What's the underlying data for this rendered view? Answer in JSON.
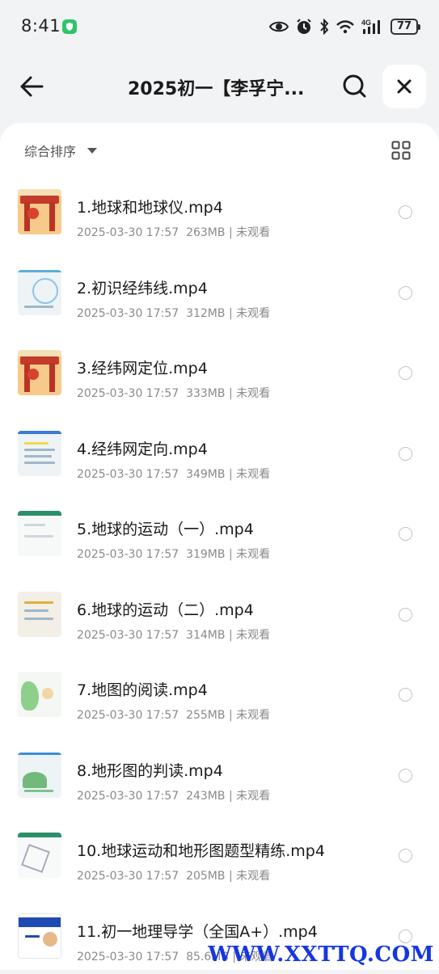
{
  "status_bar": {
    "time": "8:41",
    "network_label": "4G",
    "battery": "77",
    "icons": [
      "shield-icon",
      "eye-icon",
      "alarm-icon",
      "bluetooth-icon",
      "wifi-icon",
      "signal-icon",
      "battery-icon"
    ]
  },
  "header": {
    "title": "2025初一【李孚宁...",
    "icons": [
      "back-arrow-icon",
      "search-icon",
      "close-icon"
    ]
  },
  "toolbar": {
    "sort_label": "综合排序",
    "icons": [
      "caret-down-icon",
      "grid-view-icon"
    ]
  },
  "files": [
    {
      "name": "1.地球和地球仪.mp4",
      "date": "2025-03-30 17:57",
      "size": "263MB",
      "status": "未观看"
    },
    {
      "name": "2.初识经纬线.mp4",
      "date": "2025-03-30 17:57",
      "size": "312MB",
      "status": "未观看"
    },
    {
      "name": "3.经纬网定位.mp4",
      "date": "2025-03-30 17:57",
      "size": "333MB",
      "status": "未观看"
    },
    {
      "name": "4.经纬网定向.mp4",
      "date": "2025-03-30 17:57",
      "size": "349MB",
      "status": "未观看"
    },
    {
      "name": "5.地球的运动（一）.mp4",
      "date": "2025-03-30 17:57",
      "size": "319MB",
      "status": "未观看"
    },
    {
      "name": "6.地球的运动（二）.mp4",
      "date": "2025-03-30 17:57",
      "size": "314MB",
      "status": "未观看"
    },
    {
      "name": "7.地图的阅读.mp4",
      "date": "2025-03-30 17:57",
      "size": "255MB",
      "status": "未观看"
    },
    {
      "name": "8.地形图的判读.mp4",
      "date": "2025-03-30 17:57",
      "size": "243MB",
      "status": "未观看"
    },
    {
      "name": "10.地球运动和地形图题型精练.mp4",
      "date": "2025-03-30 17:57",
      "size": "205MB",
      "status": "未观看"
    },
    {
      "name": "11.初一地理导学（全国A+）.mp4",
      "date": "2025-03-30 17:57",
      "size": "85.6MB",
      "status": "未观看"
    }
  ],
  "meta_separator": "|",
  "watermark": "WWW.XXTTQ.COM",
  "colors": {
    "accent_green": "#2fc46b",
    "watermark_blue": "#1537e0"
  }
}
